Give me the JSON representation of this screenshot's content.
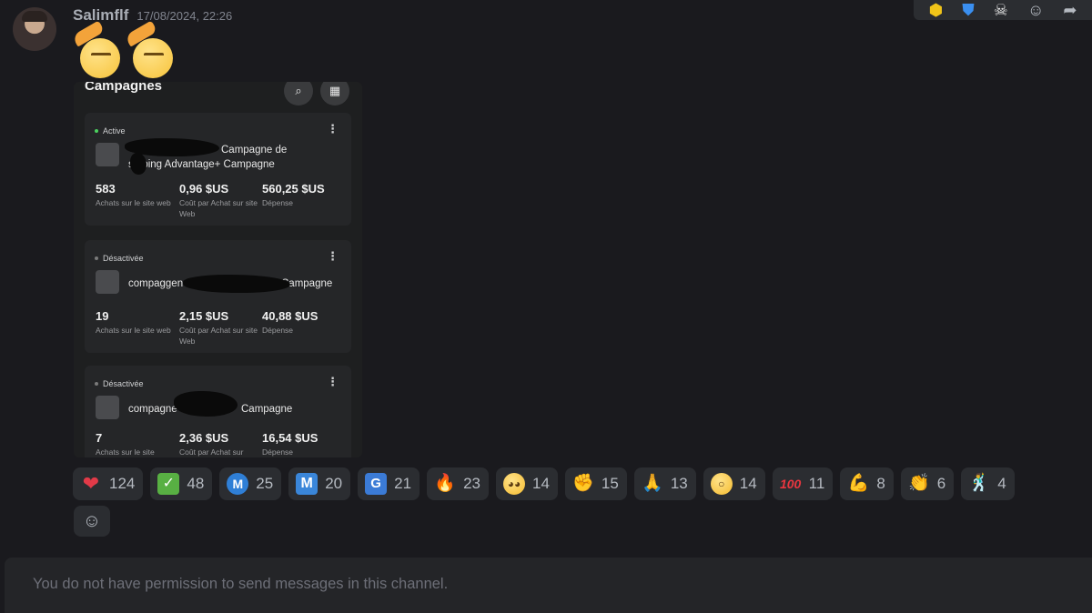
{
  "message": {
    "author": "Salimflf",
    "timestamp": "17/08/2024, 22:26"
  },
  "toolbar": {
    "icons": [
      "badge-icon",
      "shield-icon",
      "skull-icon",
      "add-reaction-icon",
      "forward-icon"
    ]
  },
  "attachment": {
    "title": "Campagnes",
    "cards": [
      {
        "status": "Active",
        "name_line1": "Campagne de",
        "name_line2": "s   pping Advantage+ Campagne",
        "metrics": [
          {
            "value": "583",
            "label": "Achats sur le site web"
          },
          {
            "value": "0,96 $US",
            "label": "Coût par Achat sur site Web"
          },
          {
            "value": "560,25 $US",
            "label": "Dépense"
          }
        ]
      },
      {
        "status": "Désactivée",
        "name_line1": "compaggen",
        "name_line2": "Campagne",
        "metrics": [
          {
            "value": "19",
            "label": "Achats sur le site web"
          },
          {
            "value": "2,15 $US",
            "label": "Coût par Achat sur site Web"
          },
          {
            "value": "40,88 $US",
            "label": "Dépense"
          }
        ]
      },
      {
        "status": "Désactivée",
        "name_line1": "compagne",
        "name_line2": "Campagne",
        "metrics": [
          {
            "value": "7",
            "label": "Achats sur le site"
          },
          {
            "value": "2,36 $US",
            "label": "Coût par Achat sur"
          },
          {
            "value": "16,54 $US",
            "label": "Dépense"
          }
        ]
      }
    ]
  },
  "reactions": [
    {
      "emoji": "❤",
      "icon": "heart-icon",
      "count": "124"
    },
    {
      "emoji": "✓",
      "icon": "check-mark-icon",
      "count": "48"
    },
    {
      "emoji": "M",
      "icon": "m-circle-icon",
      "count": "25"
    },
    {
      "emoji": "M",
      "icon": "m-square-icon",
      "count": "20"
    },
    {
      "emoji": "G",
      "icon": "g-icon",
      "count": "21"
    },
    {
      "emoji": "🔥",
      "icon": "fire-icon",
      "count": "23"
    },
    {
      "emoji": "◕◕",
      "icon": "pleading-face-icon",
      "count": "14"
    },
    {
      "emoji": "✊",
      "icon": "fist-icon",
      "count": "15"
    },
    {
      "emoji": "🙏",
      "icon": "folded-hands-icon",
      "count": "13"
    },
    {
      "emoji": "○",
      "icon": "astonished-face-icon",
      "count": "14"
    },
    {
      "emoji": "100",
      "icon": "hundred-points-icon",
      "count": "11"
    },
    {
      "emoji": "💪",
      "icon": "flexed-biceps-icon",
      "count": "8"
    },
    {
      "emoji": "👏",
      "icon": "clapping-hands-icon",
      "count": "6"
    },
    {
      "emoji": "🕺",
      "icon": "dancer-icon",
      "count": "4"
    }
  ],
  "composer": {
    "notice": "You do not have permission to send messages in this channel."
  }
}
